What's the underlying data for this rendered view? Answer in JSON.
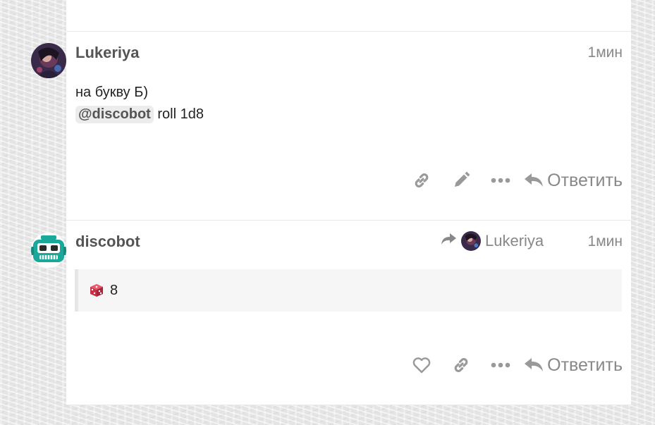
{
  "posts": [
    {
      "username": "Lukeriya",
      "time": "1мин",
      "lines": [
        "на букву Б)"
      ],
      "mention": "@discobot",
      "command": " roll 1d8",
      "reply_label": "Ответить"
    },
    {
      "username": "discobot",
      "time": "1мин",
      "reply_to_user": "Lukeriya",
      "result": "8",
      "reply_label": "Ответить"
    }
  ],
  "icons": {
    "link": "link-icon",
    "edit": "pencil-icon",
    "more": "ellipsis-icon",
    "reply": "reply-icon",
    "like": "heart-icon",
    "share": "share-arrow-icon",
    "dice": "dice-icon"
  },
  "colors": {
    "icon_gray": "#999999",
    "bot_teal": "#1aa89a",
    "dice_red": "#d9364b"
  }
}
